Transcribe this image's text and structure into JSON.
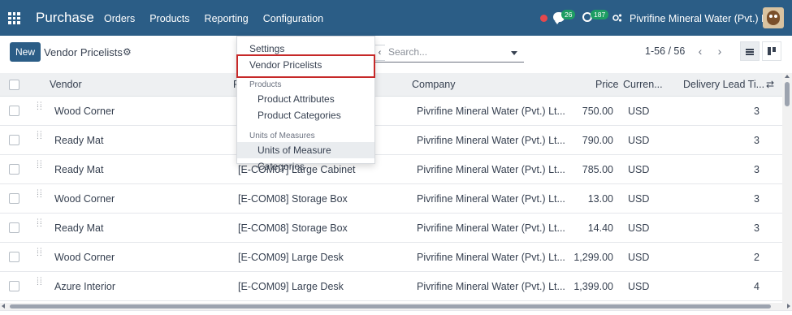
{
  "navbar": {
    "app_title": "Purchase",
    "menu": [
      "Orders",
      "Products",
      "Reporting",
      "Configuration"
    ],
    "chat_count": "26",
    "activity_count": "187",
    "company": "Pivrifine Mineral Water (Pvt.) Ltd."
  },
  "control": {
    "new_label": "New",
    "breadcrumb": "Vendor Pricelists",
    "search_placeholder": "Search...",
    "pager": "1-56 / 56"
  },
  "dropdown": {
    "settings": "Settings",
    "vendor_pricelists": "Vendor Pricelists",
    "products_header": "Products",
    "product_attributes": "Product Attributes",
    "product_categories": "Product Categories",
    "uom_header": "Units of Measures",
    "uom_categories": "Units of Measure Categories"
  },
  "table": {
    "headers": {
      "vendor": "Vendor",
      "product": "P",
      "company": "Company",
      "price": "Price",
      "currency": "Curren...",
      "lead_time": "Delivery Lead Ti..."
    },
    "rows": [
      {
        "vendor": "Wood Corner",
        "product": "",
        "company": "Pivrifine Mineral Water (Pvt.) Lt...",
        "price": "750.00",
        "currency": "USD",
        "lead_time": "3"
      },
      {
        "vendor": "Ready Mat",
        "product": "",
        "company": "Pivrifine Mineral Water (Pvt.) Lt...",
        "price": "790.00",
        "currency": "USD",
        "lead_time": "3"
      },
      {
        "vendor": "Ready Mat",
        "product": "[E-COM07] Large Cabinet",
        "company": "Pivrifine Mineral Water (Pvt.) Lt...",
        "price": "785.00",
        "currency": "USD",
        "lead_time": "3"
      },
      {
        "vendor": "Wood Corner",
        "product": "[E-COM08] Storage Box",
        "company": "Pivrifine Mineral Water (Pvt.) Lt...",
        "price": "13.00",
        "currency": "USD",
        "lead_time": "3"
      },
      {
        "vendor": "Ready Mat",
        "product": "[E-COM08] Storage Box",
        "company": "Pivrifine Mineral Water (Pvt.) Lt...",
        "price": "14.40",
        "currency": "USD",
        "lead_time": "3"
      },
      {
        "vendor": "Wood Corner",
        "product": "[E-COM09] Large Desk",
        "company": "Pivrifine Mineral Water (Pvt.) Lt...",
        "price": "1,299.00",
        "currency": "USD",
        "lead_time": "2"
      },
      {
        "vendor": "Azure Interior",
        "product": "[E-COM09] Large Desk",
        "company": "Pivrifine Mineral Water (Pvt.) Lt...",
        "price": "1,399.00",
        "currency": "USD",
        "lead_time": "4"
      }
    ]
  },
  "colors": {
    "navbar": "#2b5d86",
    "highlight_border": "#c62828",
    "badge": "#1e9e63"
  },
  "icons": [
    "apps-grid-icon",
    "chat-icon",
    "clock-icon",
    "gear-icon",
    "list-view-icon",
    "kanban-view-icon",
    "drag-handle-icon"
  ]
}
